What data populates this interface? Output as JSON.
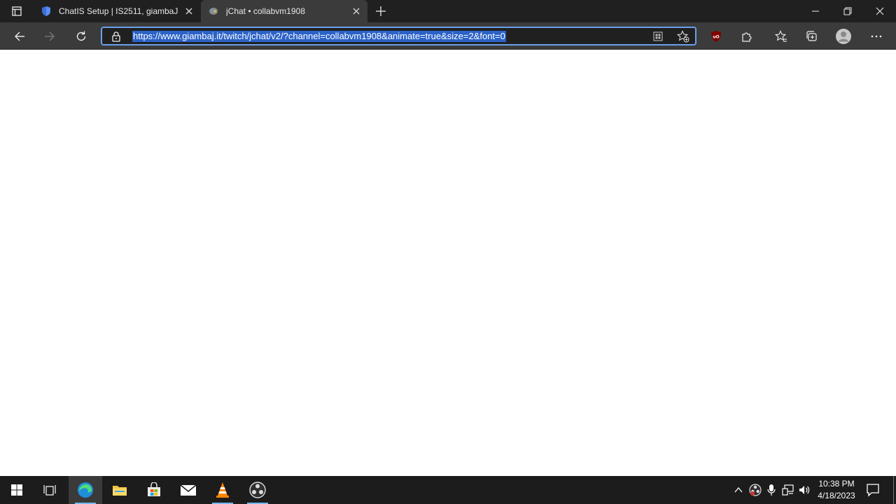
{
  "browser": {
    "tabs": [
      {
        "title": "ChatIS Setup | IS2511, giambaJ",
        "active": false
      },
      {
        "title": "jChat • collabvm1908",
        "active": true
      }
    ],
    "address_bar": {
      "url": "https://www.giambaj.it/twitch/jchat/v2/?channel=collabvm1908&animate=true&size=2&font=0",
      "url_selected": true
    },
    "accent_color": "#2b62c7"
  },
  "taskbar": {
    "apps": [
      {
        "name": "task-view"
      },
      {
        "name": "edge",
        "running": true,
        "active": true
      },
      {
        "name": "file-explorer"
      },
      {
        "name": "microsoft-store"
      },
      {
        "name": "mail"
      },
      {
        "name": "vlc",
        "running": true
      },
      {
        "name": "obs",
        "running": true
      }
    ],
    "clock": {
      "time": "10:38 PM",
      "date": "4/18/2023"
    }
  }
}
